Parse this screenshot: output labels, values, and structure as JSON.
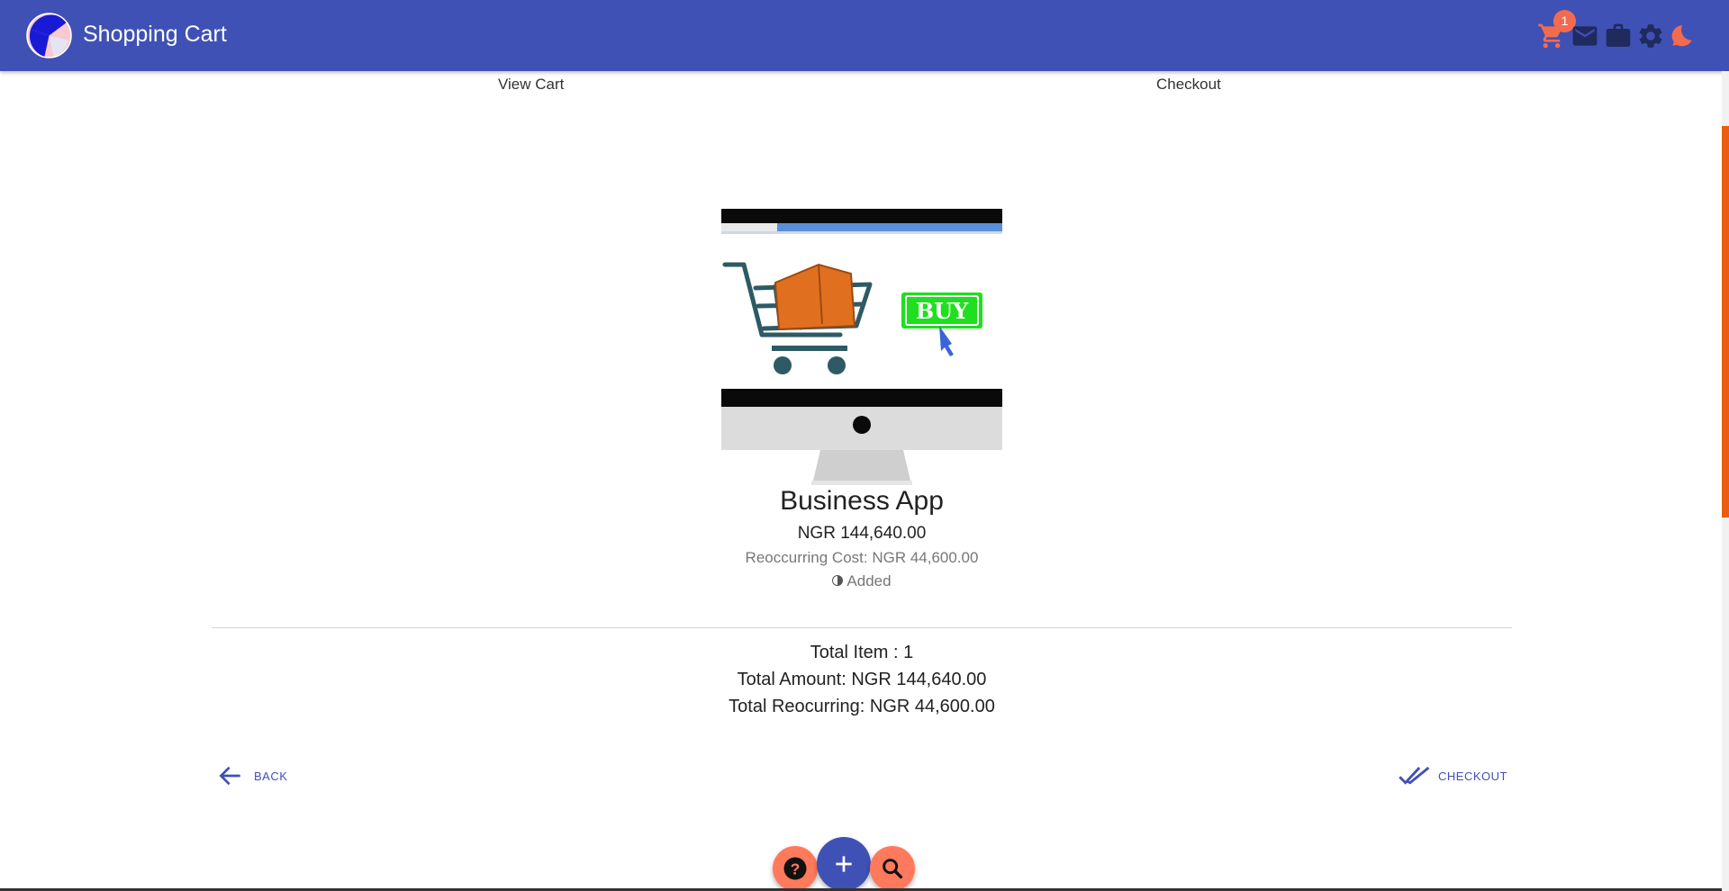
{
  "header": {
    "title": "Shopping Cart",
    "cart_count": "1",
    "icons": [
      "cart-icon",
      "mail-icon",
      "briefcase-icon",
      "gear-icon",
      "theme-icon"
    ]
  },
  "tabs": [
    {
      "label": "View Cart"
    },
    {
      "label": "Checkout"
    }
  ],
  "product": {
    "name": "Business App",
    "price": "NGR 144,640.00",
    "recurring": "Reoccurring Cost: NGR 44,600.00",
    "status": "Added",
    "image_text": "BUY"
  },
  "totals": {
    "items": "Total Item : 1",
    "amount": "Total Amount: NGR 144,640.00",
    "recurring": "Total Reocurring: NGR 44,600.00"
  },
  "actions": {
    "back_label": "BACK",
    "checkout_label": "CHECKOUT"
  },
  "fabs": [
    "help-icon",
    "add-icon",
    "search-icon"
  ],
  "colors": {
    "appbar": "#3f51b5",
    "accent": "#f26b4f",
    "fab_secondary": "#ff7a5c",
    "scrollbar_thumb": "#e85d0e",
    "buy_green": "#1ee01e"
  }
}
